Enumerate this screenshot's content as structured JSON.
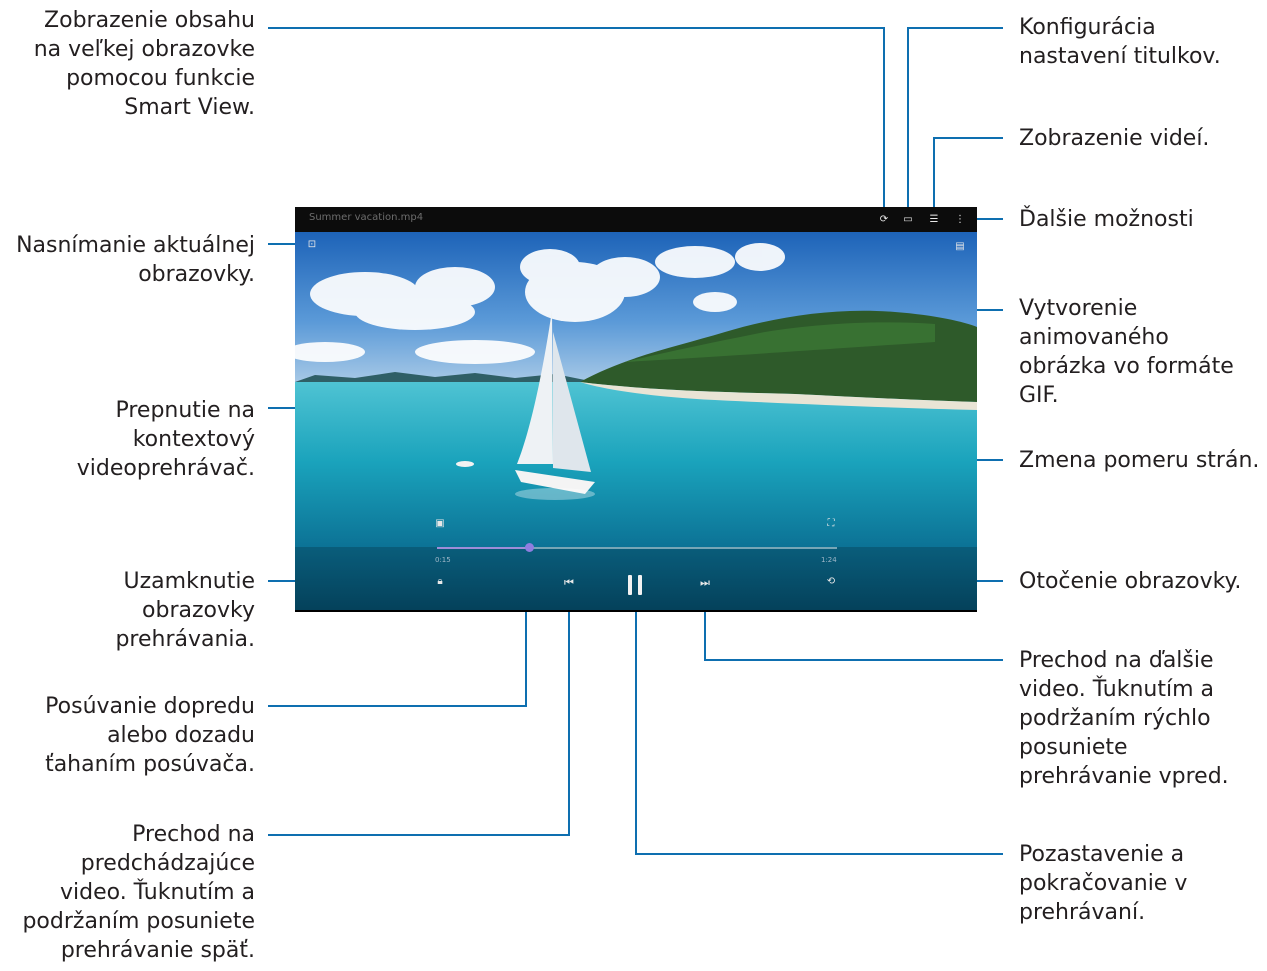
{
  "player": {
    "file_title": "Summer vacation.mp4",
    "time_elapsed": "0:15",
    "time_total": "1:24",
    "progress_fraction": 0.23,
    "icons": {
      "smart_view": "smart-view-icon",
      "subtitles": "subtitles-icon",
      "video_list": "video-list-icon",
      "more": "more-options-icon",
      "capture": "screen-capture-icon",
      "gif": "gif-icon",
      "pip": "pop-up-player-icon",
      "ratio": "screen-ratio-icon",
      "lock": "lock-icon",
      "previous": "previous-icon",
      "pause": "pause-icon",
      "next": "next-icon",
      "rotate": "rotate-icon"
    }
  },
  "callouts": {
    "smart_view": "Zobrazenie obsahu\nna veľkej obrazovke\npomocou funkcie\nSmart View.",
    "capture": "Nasnímanie aktuálnej\nobrazovky.",
    "pip": "Prepnutie na\nkontextový\nvideoprehrávač.",
    "lock": "Uzamknutie\nobrazovky\nprehrávania.",
    "seek": "Posúvanie dopredu\nalebo dozadu\nťahaním posúvača.",
    "previous": "Prechod na\npredchádzajúce\nvideo. Ťuknutím a\npodržaním posuniete\nprehrávanie späť.",
    "subtitles": "Konfigurácia\nnastavení titulkov.",
    "video_list": "Zobrazenie videí.",
    "more": "Ďalšie možnosti",
    "gif": "Vytvorenie\nanimovaného\nobrázka vo formáte\nGIF.",
    "ratio": "Zmena pomeru strán.",
    "rotate": "Otočenie obrazovky.",
    "next": "Prechod na ďalšie\nvideo. Ťuknutím a\npodržaním rýchlo\nposuniete\nprehrávanie vpred.",
    "pause": "Pozastavenie a\npokračovanie v\nprehrávaní."
  },
  "colors": {
    "callout_line": "#0e6fb0",
    "seek_thumb": "#8f7ee0",
    "text": "#231f20"
  }
}
